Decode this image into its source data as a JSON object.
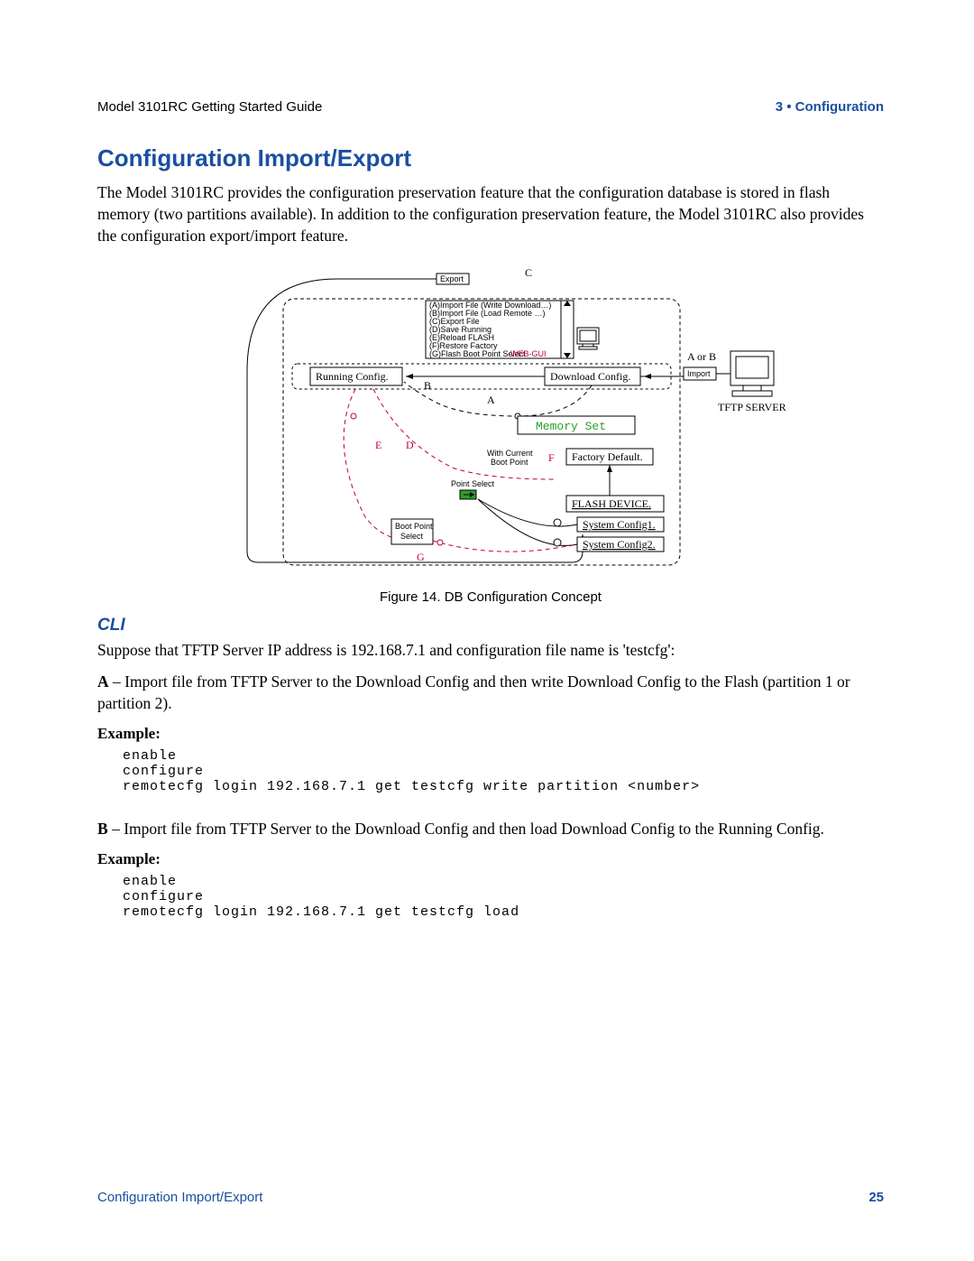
{
  "header": {
    "left": "Model 3101RC Getting Started Guide",
    "right": "3 • Configuration"
  },
  "section": {
    "title": "Configuration Import/Export",
    "intro": "The Model 3101RC provides the configuration preservation feature that the configuration database is stored in flash memory (two partitions available). In addition to the configuration preservation feature, the Model 3101RC also provides the configuration export/import feature."
  },
  "figure": {
    "caption": "Figure 14. DB Configuration Concept",
    "labels": {
      "export": "Export",
      "c": "C",
      "aorb": "A or B",
      "import": "Import",
      "tftp": "TFTP SERVER",
      "running": "Running Config.",
      "download": "Download Config.",
      "memory": "Memory Set",
      "withcurrent1": "With Current",
      "withcurrent2": "Boot Point",
      "factory": "Factory Default.",
      "flashdev": "FLASH DEVICE.",
      "sys1": "System Config1.",
      "sys2": "System Config2.",
      "pointselect": "Point Select",
      "bootpoint1": "Boot Point",
      "bootpoint2": "Select",
      "a": "A",
      "b": "B",
      "d": "D",
      "e": "E",
      "f": "F",
      "g": "G",
      "webgui": "WEB-GUI",
      "menuA": "(A)Import File (Write Download…)",
      "menuB": "(B)Import File (Load Remote …)",
      "menuC": "(C)Export File",
      "menuD": "(D)Save Running",
      "menuE": "(E)Reload FLASH",
      "menuF": "(F)Restore Factory",
      "menuG": "(G)Flash Boot Point Select"
    }
  },
  "cli": {
    "heading": "CLI",
    "suppose": "Suppose that TFTP Server IP address is 192.168.7.1 and configuration file name is 'testcfg':",
    "a_label": "A",
    "a_text": " – Import file from TFTP Server to the Download Config and then write Download Config to the Flash (partition 1 or partition 2).",
    "example_label": "Example:",
    "example_a_code": "enable\nconfigure\nremotecfg login 192.168.7.1 get testcfg write partition <number>",
    "b_label": "B",
    "b_text": " – Import file from TFTP Server to the Download Config and then load Download Config to the Running Config.",
    "example_b_code": "enable\nconfigure\nremotecfg login 192.168.7.1 get testcfg load"
  },
  "footer": {
    "left": "Configuration Import/Export",
    "right": "25"
  }
}
